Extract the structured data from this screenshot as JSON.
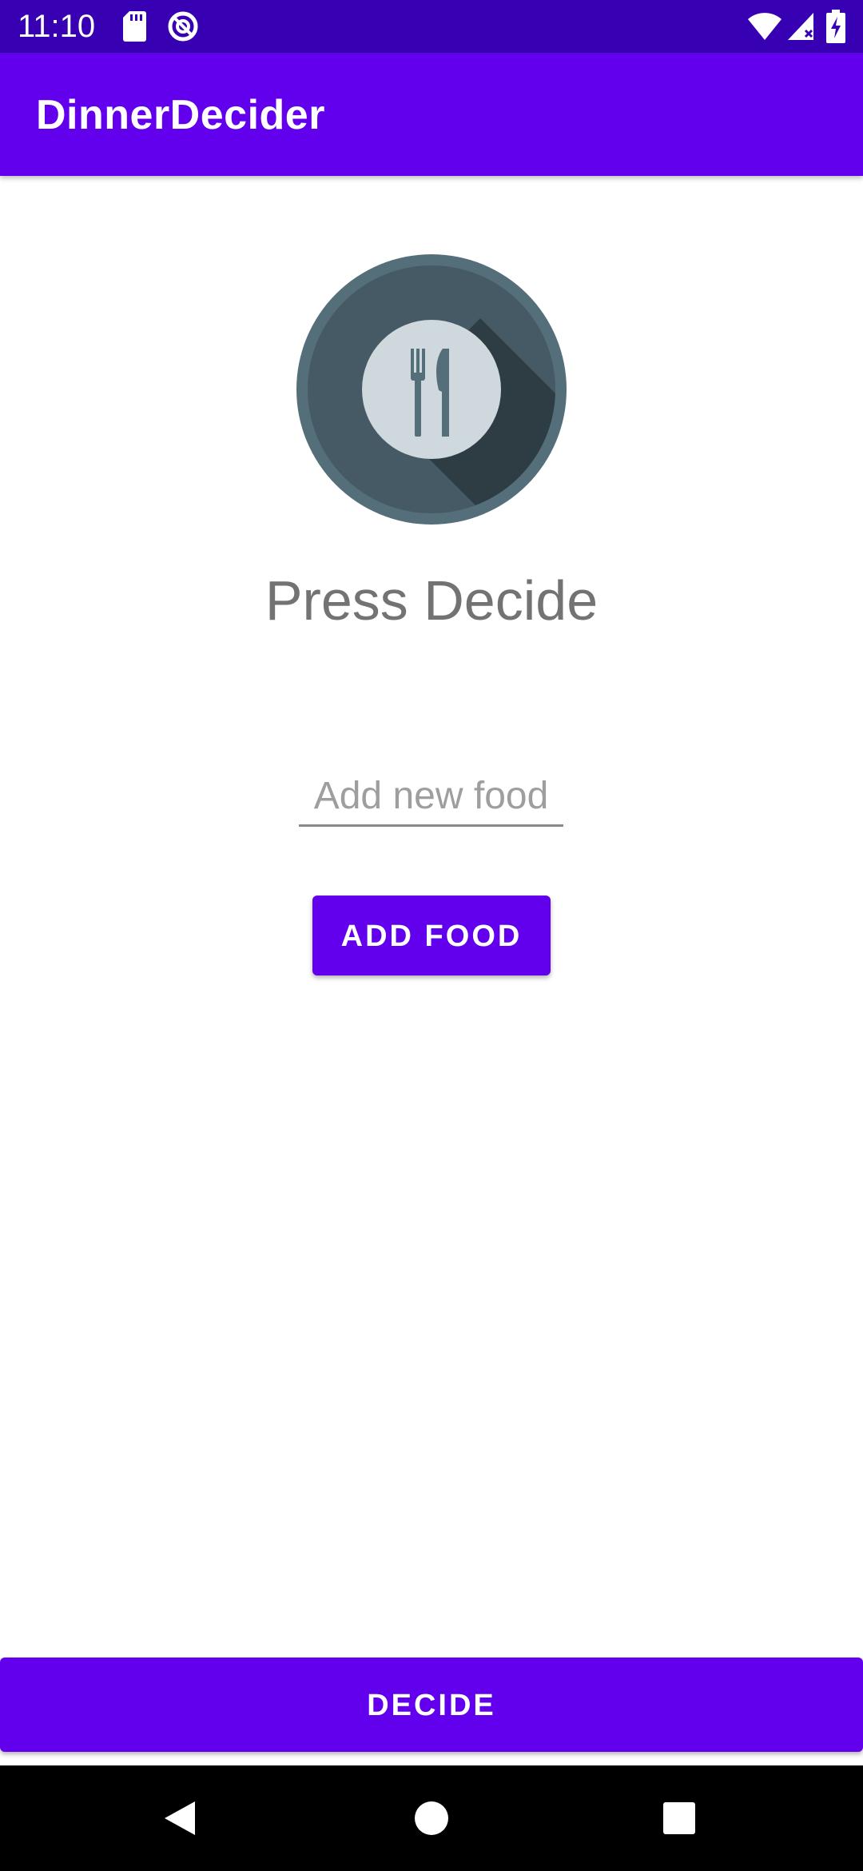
{
  "status_bar": {
    "time": "11:10",
    "icons": [
      "sd-card-icon",
      "data-saver-icon",
      "wifi-icon",
      "cell-signal-icon",
      "battery-charging-icon"
    ]
  },
  "app_bar": {
    "title": "DinnerDecider"
  },
  "main": {
    "image_icon": "plate-fork-knife-icon",
    "result_text": "Press Decide",
    "input_placeholder": "Add new food",
    "input_value": "",
    "add_button_label": "ADD FOOD",
    "decide_button_label": "DECIDE"
  },
  "nav_bar": {
    "icons": [
      "back-icon",
      "home-icon",
      "recents-icon"
    ]
  },
  "colors": {
    "status_bar": "#3700b3",
    "primary": "#6200ee",
    "result_text": "#737373",
    "plate_ring": "#546e7a",
    "plate_inner": "#455a64",
    "plate_shadow": "#2e3c43",
    "plate_center": "#cfd8dc"
  }
}
